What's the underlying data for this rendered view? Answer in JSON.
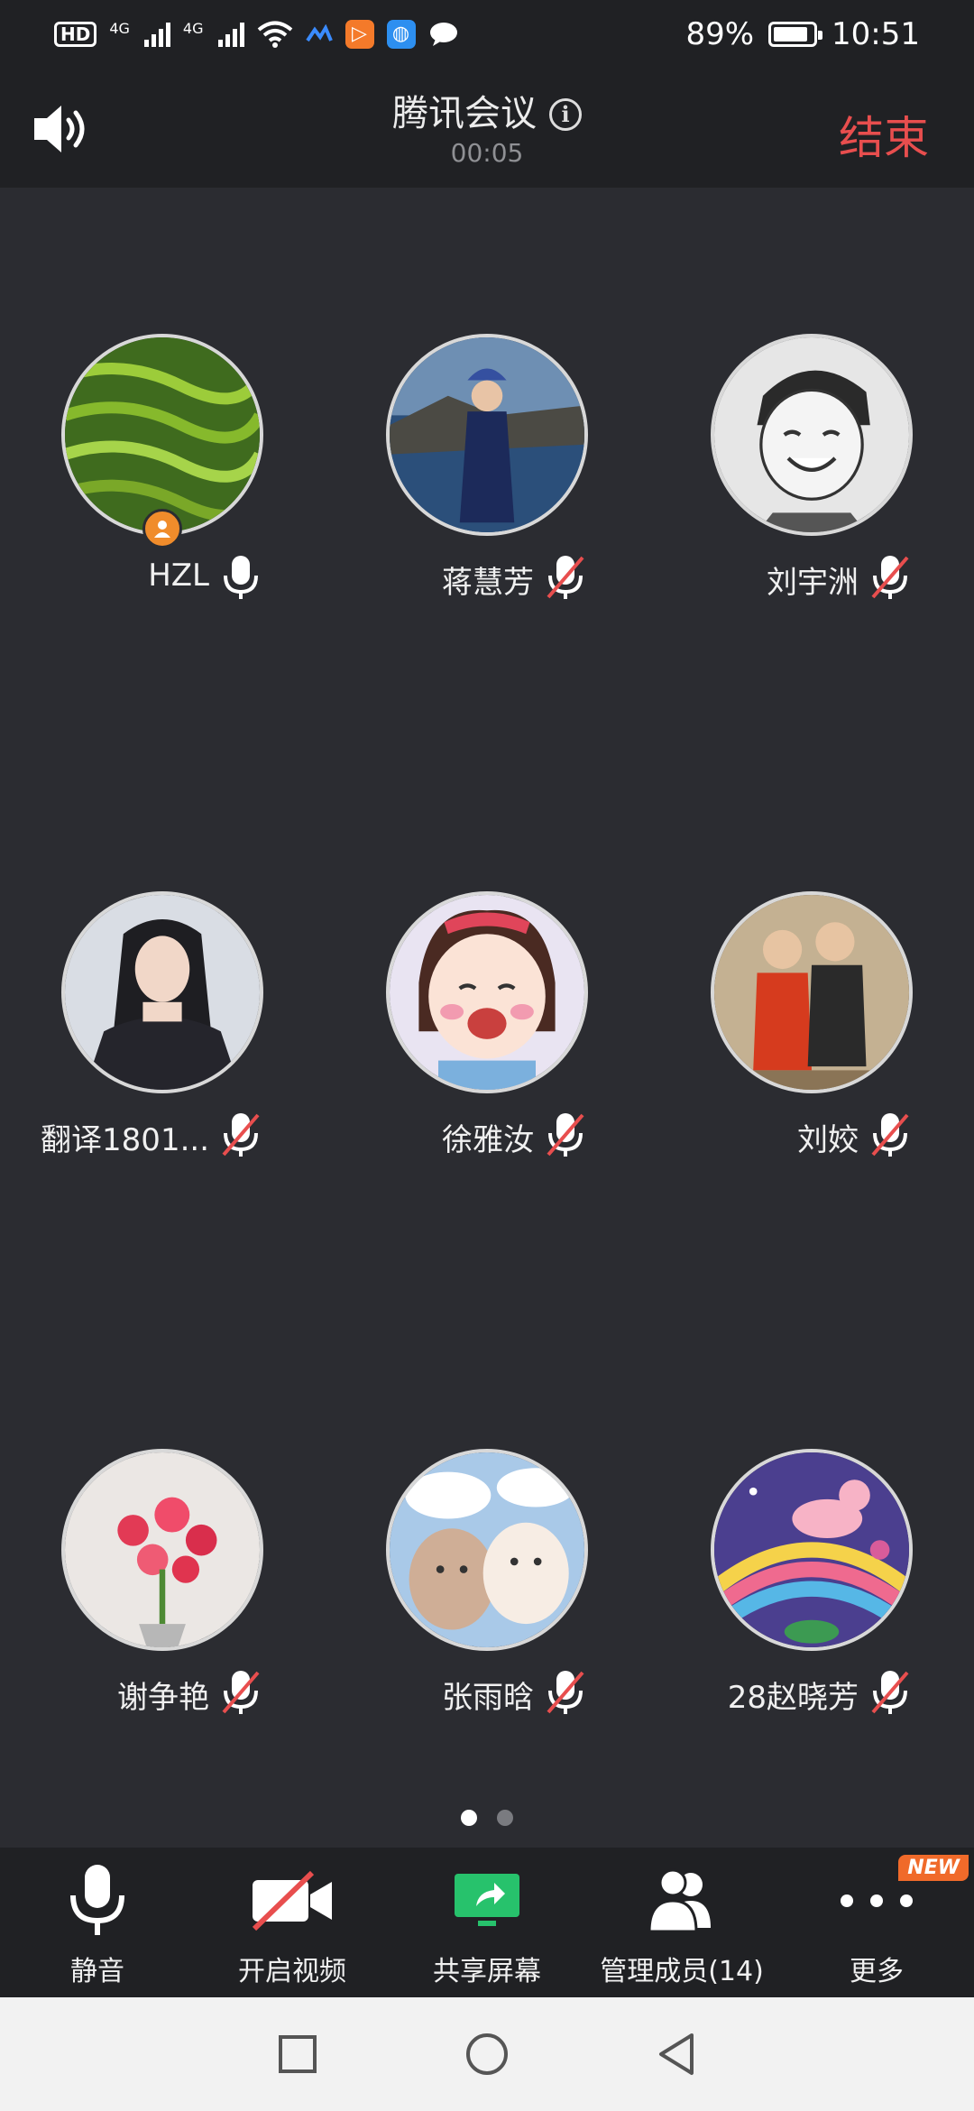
{
  "status_bar": {
    "hd": "HD",
    "network_1": "4G",
    "network_2": "4G",
    "battery": "89%",
    "time": "10:51",
    "icons": [
      "hd-icon",
      "signal-icon",
      "signal-icon",
      "wifi-icon",
      "app-icon",
      "app-icon",
      "app-icon",
      "message-icon",
      "battery-icon"
    ]
  },
  "header": {
    "title": "腾讯会议",
    "timer": "00:05",
    "end_label": "结束",
    "speaker_icon": "speaker-icon",
    "info_icon": "info-icon"
  },
  "participants": [
    {
      "name": "HZL",
      "mic": "on",
      "host": true
    },
    {
      "name": "蒋慧芳",
      "mic": "muted",
      "host": false
    },
    {
      "name": "刘宇洲",
      "mic": "muted",
      "host": false
    },
    {
      "name": "翻译1801...",
      "mic": "muted",
      "host": false
    },
    {
      "name": "徐雅汝",
      "mic": "muted",
      "host": false
    },
    {
      "name": "刘姣",
      "mic": "muted",
      "host": false
    },
    {
      "name": "谢争艳",
      "mic": "muted",
      "host": false
    },
    {
      "name": "张雨晗",
      "mic": "muted",
      "host": false
    },
    {
      "name": "28赵晓芳",
      "mic": "muted",
      "host": false
    }
  ],
  "pagination": {
    "pages": 2,
    "current": 1
  },
  "toolbar": {
    "mute_label": "静音",
    "video_label": "开启视频",
    "share_label": "共享屏幕",
    "members_label": "管理成员(14)",
    "more_label": "更多",
    "new_badge": "NEW"
  },
  "colors": {
    "background": "#2b2c31",
    "bar": "#202124",
    "end": "#e84e4e",
    "share_green": "#27c26c",
    "mute_red": "#e84e4e",
    "badge_orange": "#f06a2a"
  }
}
